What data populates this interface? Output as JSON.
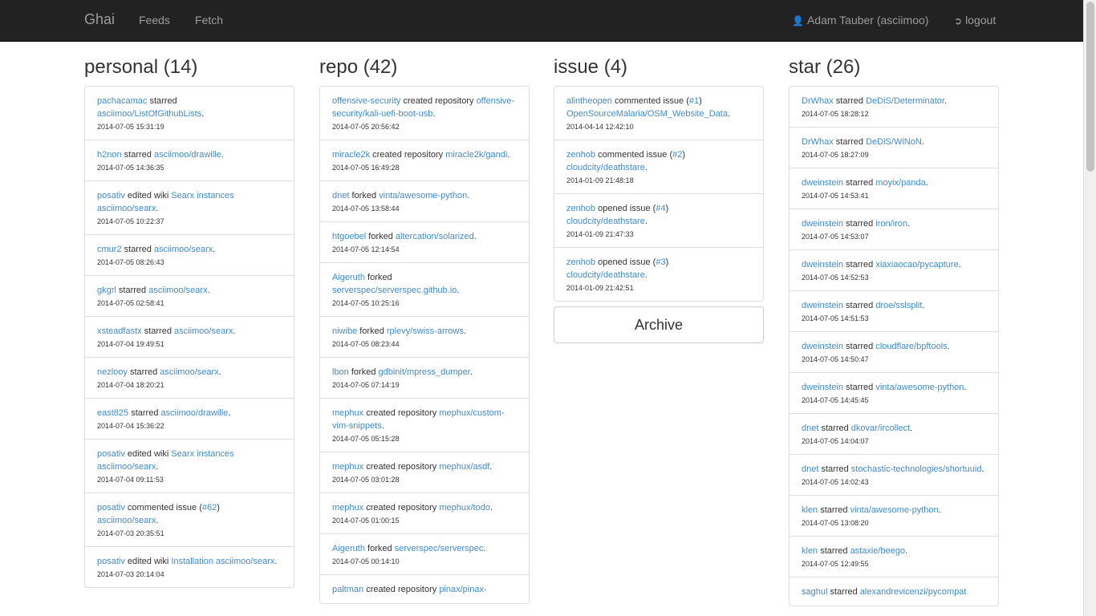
{
  "nav": {
    "brand": "Ghai",
    "links": [
      "Feeds",
      "Fetch"
    ],
    "user": "Adam Tauber (asciimoo)",
    "logout": "logout"
  },
  "columns": [
    {
      "title": "personal (14)",
      "items": [
        {
          "actor": "pachacamac",
          "verb": "starred",
          "target": "asciimoo/ListOfGithubLists",
          "ts": "2014-07-05 15:31:19"
        },
        {
          "actor": "h2non",
          "verb": "starred",
          "target": "asciimoo/drawille",
          "ts": "2014-07-05 14:36:35"
        },
        {
          "actor": "posativ",
          "verb": "edited wiki",
          "target": "Searx instances",
          "repo": "asciimoo/searx",
          "ts": "2014-07-05 10:22:37"
        },
        {
          "actor": "cmur2",
          "verb": "starred",
          "target": "asciimoo/searx",
          "ts": "2014-07-05 08:26:43"
        },
        {
          "actor": "gkgrl",
          "verb": "starred",
          "target": "asciimoo/searx",
          "ts": "2014-07-05 02:58:41"
        },
        {
          "actor": "xsteadfastx",
          "verb": "starred",
          "target": "asciimoo/searx",
          "ts": "2014-07-04 19:49:51"
        },
        {
          "actor": "nezlooy",
          "verb": "starred",
          "target": "asciimoo/searx",
          "ts": "2014-07-04 18:20:21"
        },
        {
          "actor": "east825",
          "verb": "starred",
          "target": "asciimoo/drawille",
          "ts": "2014-07-04 15:36:22"
        },
        {
          "actor": "posativ",
          "verb": "edited wiki",
          "target": "Searx instances",
          "repo": "asciimoo/searx",
          "ts": "2014-07-04 09:11:53"
        },
        {
          "actor": "posativ",
          "verb": "commented issue",
          "issue": "#62",
          "repo": "asciimoo/searx",
          "ts": "2014-07-03 20:35:51"
        },
        {
          "actor": "posativ",
          "verb": "edited wiki",
          "target": "Installation",
          "repo_inline": "asciimoo/searx",
          "ts": "2014-07-03 20:14:04"
        }
      ]
    },
    {
      "title": "repo (42)",
      "items": [
        {
          "actor": "offensive-security",
          "verb": "created repository",
          "target": "offensive-security/kali-uefi-boot-usb",
          "ts": "2014-07-05 20:56:42"
        },
        {
          "actor": "miracle2k",
          "verb": "created repository",
          "target": "miracle2k/gandi",
          "ts": "2014-07-05 16:49:28"
        },
        {
          "actor": "dnet",
          "verb": "forked",
          "target": "vinta/awesome-python",
          "ts": "2014-07-05 13:58:44"
        },
        {
          "actor": "htgoebel",
          "verb": "forked",
          "target": "altercation/solarized",
          "ts": "2014-07-05 12:14:54"
        },
        {
          "actor": "Aigeruth",
          "verb": "forked",
          "target": "serverspec/serverspec.github.io",
          "ts": "2014-07-05 10:25:16"
        },
        {
          "actor": "niwibe",
          "verb": "forked",
          "target": "rplevy/swiss-arrows",
          "ts": "2014-07-05 08:23:44"
        },
        {
          "actor": "lbon",
          "verb": "forked",
          "target": "gdbinit/mpress_dumper",
          "ts": "2014-07-05 07:14:19"
        },
        {
          "actor": "mephux",
          "verb": "created repository",
          "target": "mephux/custom-vim-snippets",
          "ts": "2014-07-05 05:15:28"
        },
        {
          "actor": "mephux",
          "verb": "created repository",
          "target": "mephux/asdf",
          "ts": "2014-07-05 03:01:28"
        },
        {
          "actor": "mephux",
          "verb": "created repository",
          "target": "mephux/todo",
          "ts": "2014-07-05 01:00:15"
        },
        {
          "actor": "Aigeruth",
          "verb": "forked",
          "target": "serverspec/serverspec",
          "ts": "2014-07-05 00:14:10"
        },
        {
          "actor": "paltman",
          "verb": "created repository",
          "target": "pinax/pinax-",
          "ts": ""
        }
      ]
    },
    {
      "title": "issue (4)",
      "items": [
        {
          "actor": "alintheopen",
          "verb": "commented issue",
          "issue": "#1",
          "repo": "OpenSourceMalaria/OSM_Website_Data",
          "ts": "2014-04-14 12:42:10"
        },
        {
          "actor": "zenhob",
          "verb": "commented issue",
          "issue": "#2",
          "repo": "cloudcity/deathstare",
          "ts": "2014-01-09 21:48:18"
        },
        {
          "actor": "zenhob",
          "verb": "opened issue",
          "issue": "#4",
          "repo": "cloudcity/deathstare",
          "ts": "2014-01-09 21:47:33"
        },
        {
          "actor": "zenhob",
          "verb": "opened issue",
          "issue": "#3",
          "repo": "cloudcity/deathstare",
          "ts": "2014-01-09 21:42:51"
        }
      ],
      "archive": "Archive"
    },
    {
      "title": "star (26)",
      "items": [
        {
          "actor": "DrWhax",
          "verb": "starred",
          "target": "DeDiS/Determinator",
          "ts": "2014-07-05 18:28:12"
        },
        {
          "actor": "DrWhax",
          "verb": "starred",
          "target": "DeDiS/WiNoN",
          "ts": "2014-07-05 18:27:09"
        },
        {
          "actor": "dweinstein",
          "verb": "starred",
          "target": "moyix/panda",
          "ts": "2014-07-05 14:53:41"
        },
        {
          "actor": "dweinstein",
          "verb": "starred",
          "target": "iron/iron",
          "ts": "2014-07-05 14:53:07"
        },
        {
          "actor": "dweinstein",
          "verb": "starred",
          "target": "xiaxiaocao/pycapture",
          "ts": "2014-07-05 14:52:53"
        },
        {
          "actor": "dweinstein",
          "verb": "starred",
          "target": "droe/sslsplit",
          "ts": "2014-07-05 14:51:53"
        },
        {
          "actor": "dweinstein",
          "verb": "starred",
          "target": "cloudflare/bpftools",
          "ts": "2014-07-05 14:50:47"
        },
        {
          "actor": "dweinstein",
          "verb": "starred",
          "target": "vinta/awesome-python",
          "ts": "2014-07-05 14:45:45"
        },
        {
          "actor": "dnet",
          "verb": "starred",
          "target": "dkovar/ircollect",
          "ts": "2014-07-05 14:04:07"
        },
        {
          "actor": "dnet",
          "verb": "starred",
          "target": "stochastic-technologies/shortuuid",
          "ts": "2014-07-05 14:02:43"
        },
        {
          "actor": "klen",
          "verb": "starred",
          "target": "vinta/awesome-python",
          "ts": "2014-07-05 13:08:20"
        },
        {
          "actor": "klen",
          "verb": "starred",
          "target": "astaxie/beego",
          "ts": "2014-07-05 12:49:55"
        },
        {
          "actor": "saghul",
          "verb": "starred",
          "target": "alexandrevicenzi/pycompat",
          "ts": ""
        }
      ]
    }
  ]
}
